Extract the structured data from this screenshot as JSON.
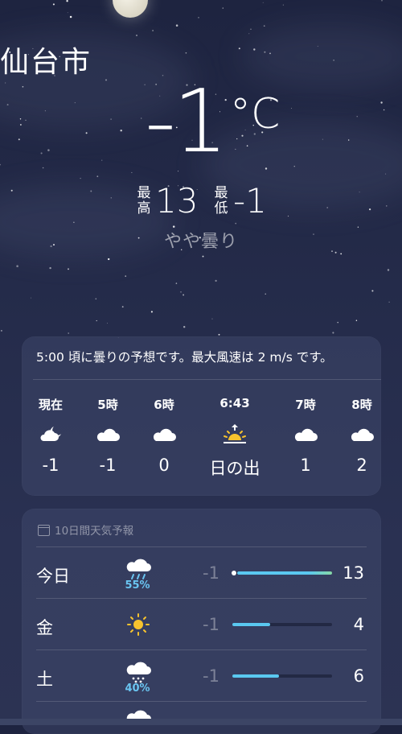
{
  "location": {
    "city": "仙台市"
  },
  "current": {
    "temperature": "-1",
    "unit": "°C",
    "high_label": "最高",
    "high": "13",
    "low_label": "最低",
    "low": "-1",
    "condition": "やや曇り"
  },
  "hourly": {
    "summary": "5:00 頃に曇りの予想です。最大風速は 2 m/s です。",
    "items": [
      {
        "time": "現在",
        "icon": "cloud-moon-icon",
        "value": "-1"
      },
      {
        "time": "5時",
        "icon": "cloud-icon",
        "value": "-1"
      },
      {
        "time": "6時",
        "icon": "cloud-icon",
        "value": "0"
      },
      {
        "time": "6:43",
        "icon": "sunrise-icon",
        "value": "日の出"
      },
      {
        "time": "7時",
        "icon": "cloud-icon",
        "value": "1"
      },
      {
        "time": "8時",
        "icon": "cloud-icon",
        "value": "2"
      }
    ]
  },
  "daily": {
    "header": "10日間天気予報",
    "days": [
      {
        "day": "今日",
        "icon": "cloud-rain-icon",
        "precip": "55%",
        "low": "-1",
        "high": "13"
      },
      {
        "day": "金",
        "icon": "sun-icon",
        "precip": "",
        "low": "-1",
        "high": "4"
      },
      {
        "day": "土",
        "icon": "cloud-snow-icon",
        "precip": "40%",
        "low": "-1",
        "high": "6"
      }
    ]
  },
  "colors": {
    "background": "#252c4b",
    "precip_text": "#6ac5f1",
    "bar_blue": "#5ac8f0",
    "bar_green": "#86d8a6",
    "sun": "#f7c32e"
  }
}
